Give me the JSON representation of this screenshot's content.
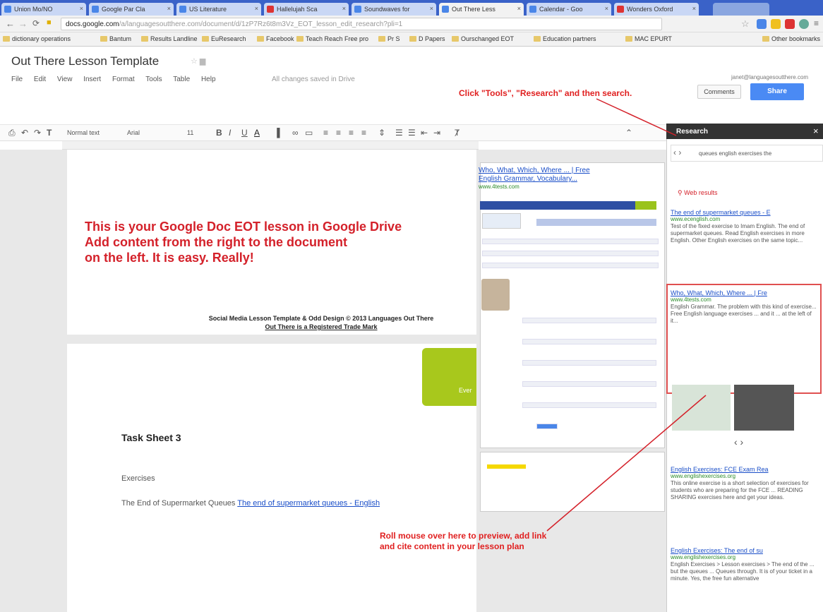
{
  "browser": {
    "tabs": [
      "Union Mo/NO",
      "Google Par Cla",
      "US Literature",
      "Hallelujah Sca",
      "Soundwaves for",
      "Out There Less",
      "Calendar - Goo",
      "Wonders Oxford"
    ],
    "active_tab_index": 5,
    "url_host": "docs.google.com",
    "url_rest": "/a/languagesoutthere.com/document/d/1zP7Rz6t8m3Vz_EOT_lesson_edit_research?pli=1",
    "bookmarks": [
      "dictionary operations",
      "Bantum",
      "Results Landline",
      "EuResearch",
      "Facebook",
      "Teach Reach Free pro",
      "Pr S",
      "D Papers",
      "Ourschanged EOT",
      "Education partners",
      "MAC EPURT",
      "Other bookmarks"
    ]
  },
  "doc": {
    "title": "Out There Lesson Template",
    "menus": [
      "File",
      "Edit",
      "View",
      "Insert",
      "Format",
      "Tools",
      "Table",
      "Help"
    ],
    "save_status": "All changes saved in Drive",
    "user_email": "janet@languagesoutthere.com",
    "comments_label": "Comments",
    "share_label": "Share",
    "toolbar": {
      "style": "Normal text",
      "font": "Arial",
      "size": "11"
    }
  },
  "annotations": {
    "top": "Click \"Tools\", \"Research\" and then search.",
    "bottom_line1": "Roll mouse over here to preview, add link",
    "bottom_line2": "and cite content in your lesson plan"
  },
  "page1": {
    "red_line1": "This is your Google Doc EOT lesson in Google Drive",
    "red_line2": "Add content from the right to the document",
    "red_line3": "on the left. It is easy. Really!",
    "copyright_line1": "Social Media Lesson Template & Odd Design © 2013 Languages Out There",
    "copyright_line2": "Out There is a Registered Trade Mark"
  },
  "page2": {
    "green_label": "Ever",
    "task_title": "Task Sheet 3",
    "exercises": "Exercises",
    "supermarket_prefix": "The End of Supermarket Queues",
    "supermarket_link": "The end of supermarket queues - English"
  },
  "preview": {
    "title_line1": "Who, What, Which, Where ... | Free",
    "title_line2": "English Grammar, Vocabulary...",
    "url": "www.4tests.com"
  },
  "research": {
    "title": "Research",
    "close": "×",
    "query": "queues english exercises the",
    "web_results_label": "Web results",
    "results": [
      {
        "title": "The end of supermarket queues - E",
        "url": "www.ecenglish.com",
        "snippet": "Test of the fixed exercise to Imam English. The end of supermarket queues. Read English exercises in more English. Other English exercises on the same topic..."
      },
      {
        "title": "Who, What, Which, Where ... | Fre",
        "url": "www.4tests.com",
        "snippet": "English Grammar. The problem with this kind of exercise... Free English language exercises ... and it ... at the left of it..."
      },
      {
        "title": "English Exercises: FCE Exam Rea",
        "url": "www.englishexercises.org",
        "snippet": "This online exercise is a short selection of exercises for students who are preparing for the FCE ... READING SHARING exercises here and get your ideas."
      },
      {
        "title": "English Exercises: The end of su",
        "url": "www.englishexercises.org",
        "snippet": "English Exercises > Lesson exercises > The end of the ... but the queues ... Queues through. It is of your ticket in a minute. Yes, the free fun alternative"
      }
    ]
  }
}
